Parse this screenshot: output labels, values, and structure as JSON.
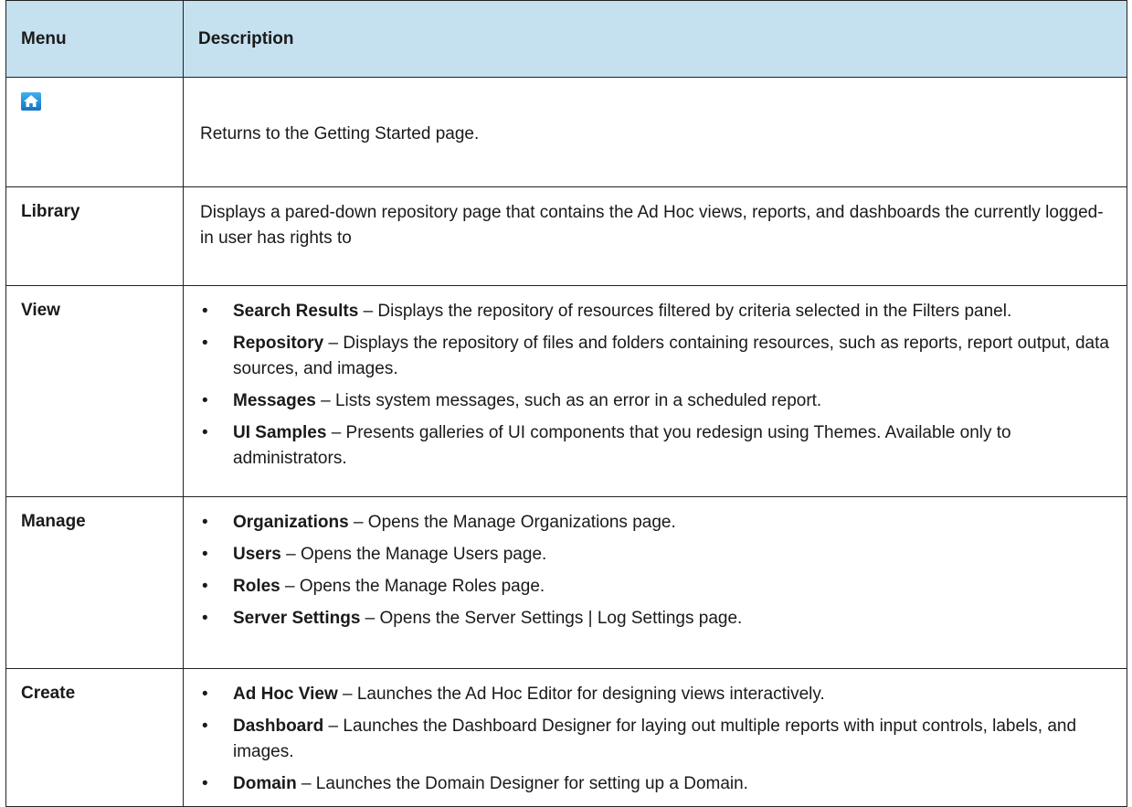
{
  "header": {
    "menu": "Menu",
    "description": "Description"
  },
  "rows": [
    {
      "menu": "",
      "icon": "home-icon",
      "description": "Returns to the Getting Started page."
    },
    {
      "menu": "Library",
      "description": "Displays a pared-down repository page that contains the Ad Hoc views, reports, and dashboards the currently logged-in user has rights to"
    },
    {
      "menu": "View",
      "items": [
        {
          "term": "Search Results",
          "text": " – Displays the repository of resources filtered by criteria selected in the Filters panel."
        },
        {
          "term": "Repository",
          "text": " – Displays the repository of files and folders containing resources, such as reports, report output, data sources, and images."
        },
        {
          "term": "Messages",
          "text": " – Lists system messages, such as an error in a scheduled report."
        },
        {
          "term": "UI Samples",
          "text": " – Presents galleries of UI components that you redesign using Themes. Available only to administrators."
        }
      ]
    },
    {
      "menu": "Manage",
      "items": [
        {
          "term": "Organizations",
          "text": "  – Opens the Manage Organizations page."
        },
        {
          "term": "Users",
          "text": "  – Opens the Manage Users page."
        },
        {
          "term": "Roles",
          "text": "  – Opens the Manage Roles page."
        },
        {
          "term": "Server Settings",
          "text": "  – Opens the Server Settings | Log Settings page."
        }
      ]
    },
    {
      "menu": "Create",
      "items": [
        {
          "term": "Ad Hoc View",
          "text": " – Launches the Ad Hoc Editor for designing views interactively."
        },
        {
          "term": "Dashboard",
          "text": " – Launches the Dashboard Designer for laying out multiple reports with input controls, labels, and images."
        },
        {
          "term": "Domain",
          "text": " – Launches the Domain Designer for setting up a Domain."
        }
      ]
    }
  ],
  "bullet_char": "•",
  "colors": {
    "header_bg": "#c5e0ee",
    "border": "#222222",
    "icon_blue": "#1e8fd6"
  }
}
